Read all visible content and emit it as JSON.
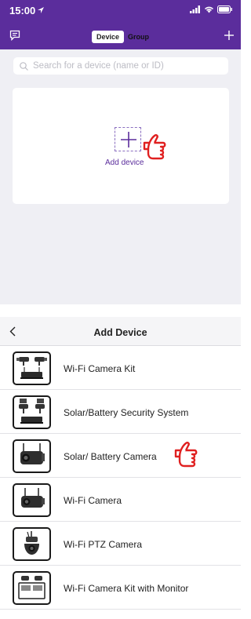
{
  "status_bar": {
    "time": "15:00"
  },
  "top_header": {
    "tabs": [
      {
        "label": "Device",
        "active": true
      },
      {
        "label": "Group",
        "active": false
      }
    ]
  },
  "search": {
    "placeholder": "Search for a device (name or ID)"
  },
  "empty_state": {
    "add_label": "Add device"
  },
  "add_device_screen": {
    "title": "Add Device",
    "items": [
      {
        "label": "Wi-Fi Camera Kit",
        "icon": "camera-kit-icon"
      },
      {
        "label": "Solar/Battery Security System",
        "icon": "solar-system-icon"
      },
      {
        "label": "Solar/ Battery Camera",
        "icon": "battery-camera-icon",
        "pointer": true
      },
      {
        "label": "Wi-Fi Camera",
        "icon": "wifi-camera-icon"
      },
      {
        "label": "Wi-Fi PTZ Camera",
        "icon": "ptz-camera-icon"
      },
      {
        "label": "Wi-Fi Camera Kit with Monitor",
        "icon": "monitor-kit-icon"
      }
    ]
  },
  "colors": {
    "brand_purple": "#5b2d9c",
    "pointer_red": "#e02020"
  }
}
